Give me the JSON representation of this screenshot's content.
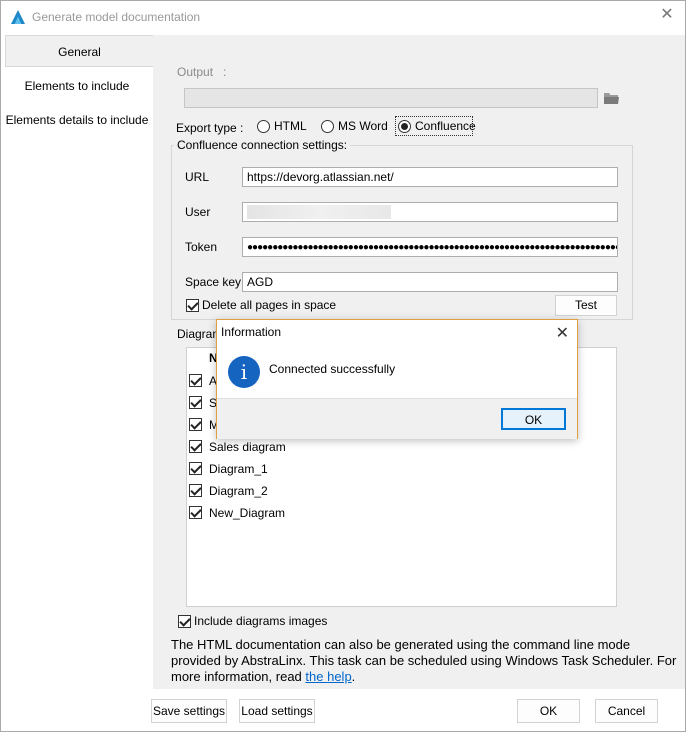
{
  "window": {
    "title": "Generate model documentation"
  },
  "sidebar": {
    "items": [
      {
        "label": "General"
      },
      {
        "label": "Elements to include"
      },
      {
        "label": "Elements details to include"
      }
    ]
  },
  "output": {
    "label": "Output",
    "colon": ":",
    "value": ""
  },
  "export_type": {
    "label": "Export type :",
    "options": [
      "HTML",
      "MS Word",
      "Confluence"
    ],
    "selected": "Confluence"
  },
  "confluence": {
    "group_title": "Confluence connection settings:",
    "url_label": "URL",
    "url_value": "https://devorg.atlassian.net/",
    "user_label": "User",
    "user_value": "",
    "token_label": "Token",
    "token_value": "●●●●●●●●●●●●●●●●●●●●●●●●●●●●●●●●●●●●●●●●●●●●●●●●●●●●●●●●●●●●●●●●●●●●●●●●●●●●●●●",
    "space_key_label": "Space key",
    "space_key_value": "AGD",
    "delete_pages_label": "Delete all pages in space",
    "delete_pages_checked": true,
    "test_button": "Test"
  },
  "diagrams": {
    "group_title": "Diagram",
    "header_partial": "N",
    "rows": [
      {
        "name": "A",
        "checked": true
      },
      {
        "name": "S",
        "checked": true
      },
      {
        "name": "M",
        "checked": true
      },
      {
        "name": "Sales diagram",
        "checked": true
      },
      {
        "name": "Diagram_1",
        "checked": true
      },
      {
        "name": "Diagram_2",
        "checked": true
      },
      {
        "name": "New_Diagram",
        "checked": true
      }
    ]
  },
  "include_images": {
    "label": "Include diagrams images",
    "checked": true
  },
  "info": {
    "text": "The HTML documentation can also be generated using the command line mode provided by AbstraLinx. This task can be scheduled using Windows Task Scheduler. For more information, read ",
    "link": "the help",
    "end": "."
  },
  "footer": {
    "save_settings": "Save settings",
    "load_settings": "Load settings",
    "ok": "OK",
    "cancel": "Cancel"
  },
  "dialog": {
    "title": "Information",
    "message": "Connected successfully",
    "ok": "OK"
  }
}
